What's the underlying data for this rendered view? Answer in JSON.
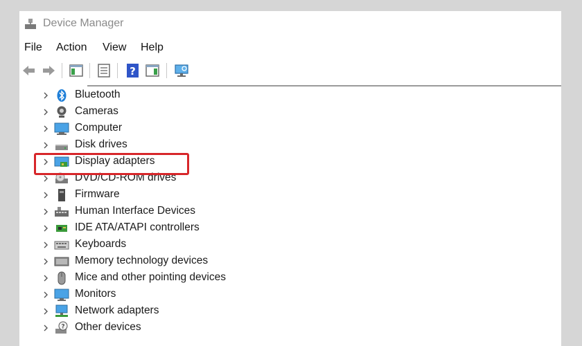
{
  "window": {
    "title": "Device Manager"
  },
  "menu": {
    "file": "File",
    "action": "Action",
    "view": "View",
    "help": "Help"
  },
  "toolbar": {
    "icons": [
      "back-arrow-icon",
      "forward-arrow-icon",
      "console-tree-icon",
      "properties-icon",
      "help-icon",
      "action-pane-icon",
      "scan-hardware-icon"
    ]
  },
  "tree": {
    "items": [
      {
        "label": "Bluetooth",
        "icon": "bluetooth-icon"
      },
      {
        "label": "Cameras",
        "icon": "camera-icon"
      },
      {
        "label": "Computer",
        "icon": "computer-icon"
      },
      {
        "label": "Disk drives",
        "icon": "disk-drive-icon"
      },
      {
        "label": "Display adapters",
        "icon": "display-adapter-icon"
      },
      {
        "label": "DVD/CD-ROM drives",
        "icon": "dvd-drive-icon"
      },
      {
        "label": "Firmware",
        "icon": "firmware-icon"
      },
      {
        "label": "Human Interface Devices",
        "icon": "hid-icon"
      },
      {
        "label": "IDE ATA/ATAPI controllers",
        "icon": "ide-controller-icon"
      },
      {
        "label": "Keyboards",
        "icon": "keyboard-icon"
      },
      {
        "label": "Memory technology devices",
        "icon": "memory-device-icon"
      },
      {
        "label": "Mice and other pointing devices",
        "icon": "mouse-icon"
      },
      {
        "label": "Monitors",
        "icon": "monitor-icon"
      },
      {
        "label": "Network adapters",
        "icon": "network-adapter-icon"
      },
      {
        "label": "Other devices",
        "icon": "other-devices-icon"
      }
    ]
  },
  "colors": {
    "highlight": "#d7262a",
    "accent": "#1f7fd8"
  }
}
